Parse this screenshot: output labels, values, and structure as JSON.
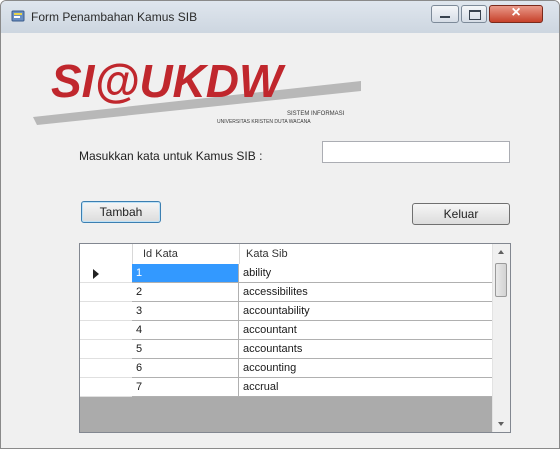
{
  "window": {
    "title": "Form Penambahan Kamus SIB"
  },
  "logo": {
    "text": "SI@UKDW",
    "line1": "SISTEM INFORMASI",
    "line2": "UNIVERSITAS KRISTEN DUTA WACANA",
    "accent_color": "#c0272d",
    "text_color": "#3a3a3a"
  },
  "form": {
    "kata_label": "Masukkan kata untuk Kamus SIB :",
    "kata_value": "",
    "tambah_label": "Tambah",
    "keluar_label": "Keluar"
  },
  "grid": {
    "columns": [
      "Id Kata",
      "Kata Sib"
    ],
    "rows": [
      {
        "id": "1",
        "kata": "ability",
        "selected": true
      },
      {
        "id": "2",
        "kata": "accessibilites",
        "selected": false
      },
      {
        "id": "3",
        "kata": "accountability",
        "selected": false
      },
      {
        "id": "4",
        "kata": "accountant",
        "selected": false
      },
      {
        "id": "5",
        "kata": "accountants",
        "selected": false
      },
      {
        "id": "6",
        "kata": "accounting",
        "selected": false
      },
      {
        "id": "7",
        "kata": "accrual",
        "selected": false
      }
    ],
    "selection_color": "#3399ff"
  }
}
